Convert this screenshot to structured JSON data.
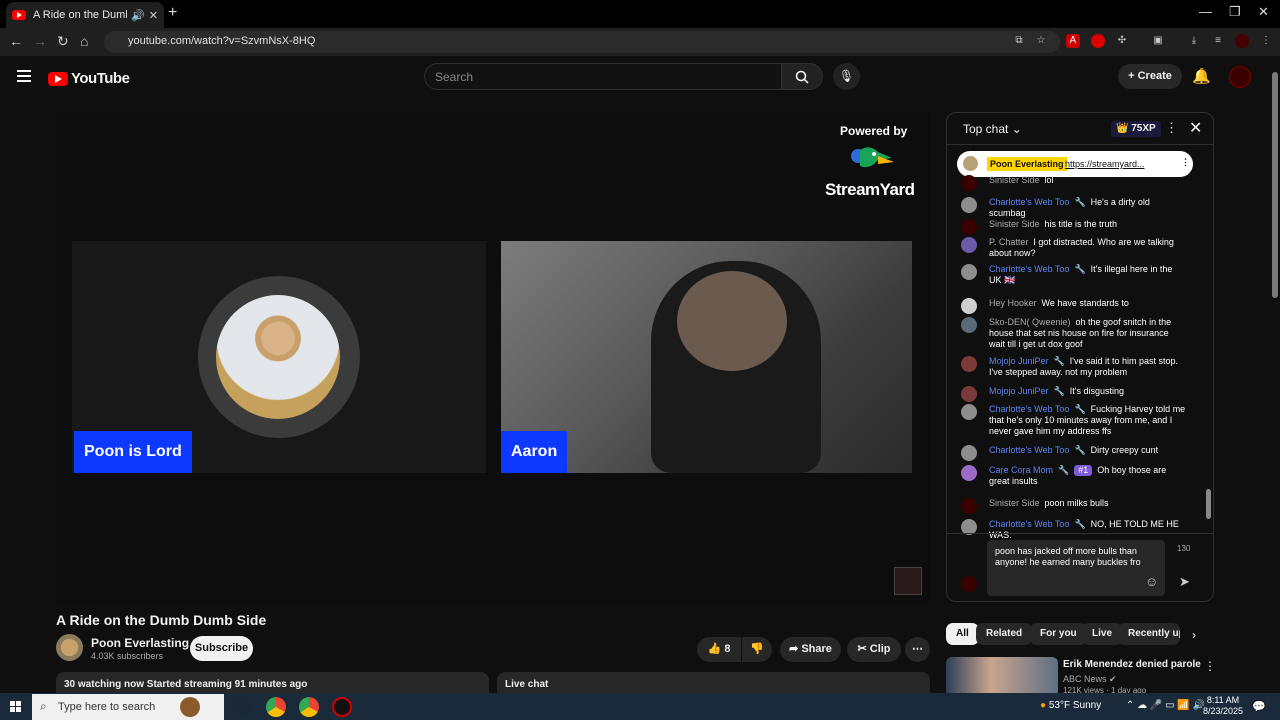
{
  "browser": {
    "tab_title": "A Ride on the Dumb Dumb Side",
    "url": "youtube.com/watch?v=SzvmNsX-8HQ"
  },
  "header": {
    "logo_text": "YouTube",
    "search_placeholder": "Search",
    "create_label": "Create"
  },
  "video": {
    "powered_by": "Powered by",
    "brand": "StreamYard",
    "tile1_name": "Poon is Lord",
    "tile2_name": "Aaron",
    "title": "A Ride on the Dumb Dumb Side"
  },
  "channel": {
    "name": "Poon Everlasting",
    "subscribers": "4.03K subscribers",
    "subscribe_label": "Subscribe"
  },
  "actions": {
    "like_count": "8",
    "share_label": "Share",
    "clip_label": "Clip"
  },
  "meta": {
    "watching": "30 watching now  Started streaming 91 minutes ago",
    "live_chat_label": "Live chat"
  },
  "chat": {
    "mode": "Top chat",
    "xp": "75XP",
    "pinned": {
      "author": "Poon Everlasting",
      "link": "https://streamyard..."
    },
    "messages": [
      {
        "author": "Sinister Side",
        "text": "lol",
        "mod": false
      },
      {
        "author": "Charlotte's Web Too",
        "text": "He's a dirty old scumbag",
        "mod": true
      },
      {
        "author": "Sinister Side",
        "text": "his title is the truth",
        "mod": false
      },
      {
        "author": "P. Chatter",
        "text": "I got distracted. Who are we talking about now?",
        "mod": false
      },
      {
        "author": "Charlotte's Web Too",
        "text": "It's illegal here in the UK 🇬🇧",
        "mod": true
      },
      {
        "author": "Hey Hooker",
        "text": "We have standards to",
        "mod": false
      },
      {
        "author": "Sko-DEN( Qweenie)",
        "text": "oh the goof snitch in the house that set nis house on fire for insurance wait till i get ut dox goof",
        "mod": false
      },
      {
        "author": "Mojojo JuniPer",
        "text": "I've said it to him past stop. I've stepped away. not my problem",
        "mod": true
      },
      {
        "author": "Mojojo JuniPer",
        "text": "It's disgusting",
        "mod": true
      },
      {
        "author": "Charlotte's Web Too",
        "text": "Fucking Harvey told me that he's only 10 minutes away from me, and I never gave him my address ffs",
        "mod": true
      },
      {
        "author": "Charlotte's Web Too",
        "text": "Dirty creepy cunt",
        "mod": true
      },
      {
        "author": "Caŗe Coŗa Mom",
        "badge": "#1",
        "text": "Oh boy those are great insults",
        "mod": true
      },
      {
        "author": "Sinister Side",
        "text": "poon milks bulls",
        "mod": false
      },
      {
        "author": "Charlotte's Web Too",
        "text": "NO, HE TOLD ME HE WAS.",
        "mod": true
      }
    ],
    "input_text": "poon has jacked off more bulls than anyone! he earned many buckles fro",
    "char_count": "130"
  },
  "chips": [
    "All",
    "Related",
    "For you",
    "Live",
    "Recently up"
  ],
  "recommendation": {
    "title": "Erik Menendez denied parole",
    "channel": "ABC News",
    "meta": "121K views · 1 day ago"
  },
  "taskbar": {
    "search_placeholder": "Type here to search",
    "weather": "53°F  Sunny",
    "time": "8:11 AM",
    "date": "8/23/2025"
  }
}
